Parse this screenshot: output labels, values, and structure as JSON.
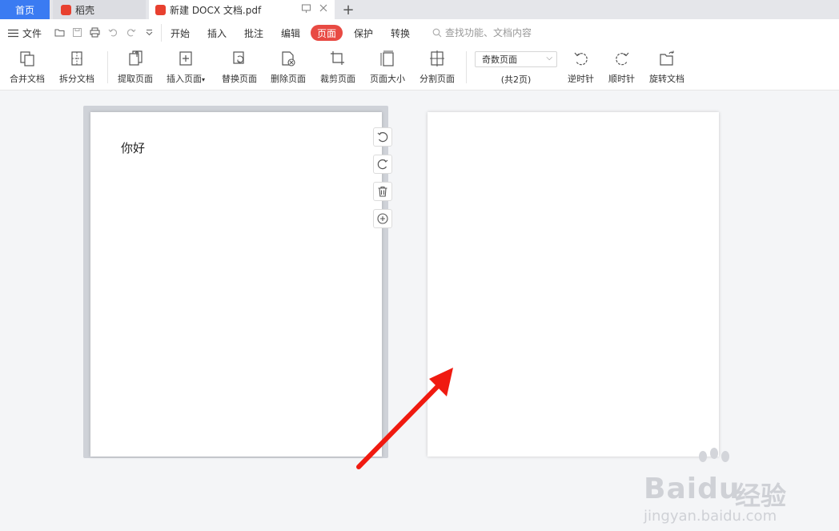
{
  "tabs": {
    "home": "首页",
    "daoke": "稻壳",
    "doc": "新建 DOCX 文档.pdf",
    "new_tab": "+"
  },
  "menu": {
    "file": "文件",
    "items": [
      "开始",
      "插入",
      "批注",
      "编辑",
      "页面",
      "保护",
      "转换"
    ],
    "active": "页面",
    "search_placeholder": "查找功能、文档内容"
  },
  "ribbon": {
    "merge": "合并文档",
    "split": "拆分文档",
    "extract": "提取页面",
    "insert": "插入页面",
    "replace": "替换页面",
    "delete": "删除页面",
    "crop": "裁剪页面",
    "page_size": "页面大小",
    "divide": "分割页面",
    "select_value": "奇数页面",
    "page_count": "(共2页)",
    "rotate_ccw": "逆时针",
    "rotate_cw": "顺时针",
    "rotate_doc": "旋转文档"
  },
  "document": {
    "page1_text": "你好"
  },
  "watermark": {
    "brand": "Baidu",
    "cn": "经验",
    "url": "jingyan.baidu.com"
  },
  "colors": {
    "accent_blue": "#3a7bf2",
    "accent_red": "#e84a43",
    "arrow_red": "#f01a10"
  }
}
